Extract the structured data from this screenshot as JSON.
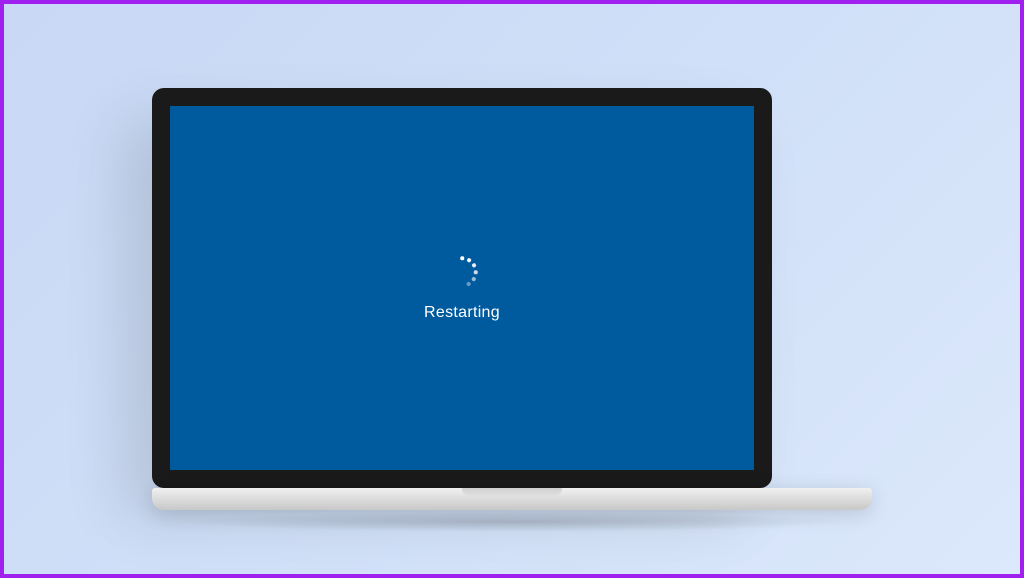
{
  "restart_screen": {
    "status_text": "Restarting",
    "background_color": "#005a9e",
    "spinner_color": "#ffffff"
  }
}
